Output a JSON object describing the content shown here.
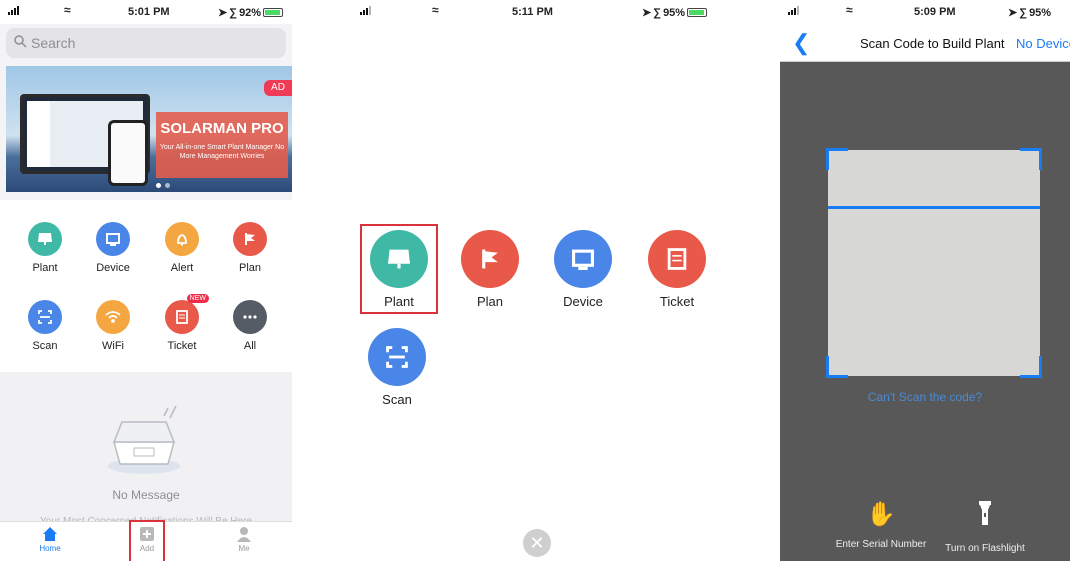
{
  "colors": {
    "accent_blue": "#1a7cf5",
    "highlight_red": "#d8323c",
    "plant_teal": "#3fb9a6",
    "device_blue": "#4a86e8",
    "alert_orange": "#f4a640",
    "plan_red": "#e8594a",
    "scan_blue": "#4a86e8",
    "wifi_orange": "#f4a640",
    "ticket_red": "#e8594a",
    "all_gray": "#555c66"
  },
  "panel1": {
    "status": {
      "time": "5:01 PM",
      "battery": "92%"
    },
    "search": {
      "placeholder": "Search"
    },
    "banner": {
      "badge": "AD",
      "title": "SOLARMAN PRO",
      "subtitle": "Your All-in-one Smart Plant Manager No More Management Worries"
    },
    "grid": [
      {
        "label": "Plant",
        "icon": "solar-panel-icon"
      },
      {
        "label": "Device",
        "icon": "device-icon"
      },
      {
        "label": "Alert",
        "icon": "bell-icon"
      },
      {
        "label": "Plan",
        "icon": "flag-icon"
      },
      {
        "label": "Scan",
        "icon": "scan-icon"
      },
      {
        "label": "WiFi",
        "icon": "wifi-icon"
      },
      {
        "label": "Ticket",
        "icon": "ticket-icon",
        "badge": "NEW"
      },
      {
        "label": "All",
        "icon": "more-icon"
      }
    ],
    "message": {
      "empty": "No Message",
      "sub": "Your Most Concerned Notifications Will Be Here"
    },
    "tabs": [
      {
        "label": "Home",
        "icon": "home-icon"
      },
      {
        "label": "Add",
        "icon": "add-icon"
      },
      {
        "label": "Me",
        "icon": "user-icon"
      }
    ]
  },
  "panel2": {
    "status": {
      "time": "5:11 PM",
      "battery": "95%"
    },
    "items": [
      {
        "label": "Plant",
        "icon": "solar-panel-icon"
      },
      {
        "label": "Plan",
        "icon": "flag-icon"
      },
      {
        "label": "Device",
        "icon": "device-icon"
      },
      {
        "label": "Ticket",
        "icon": "ticket-icon"
      },
      {
        "label": "Scan",
        "icon": "scan-icon"
      }
    ]
  },
  "panel3": {
    "status": {
      "time": "5:09 PM",
      "battery": "95%"
    },
    "nav": {
      "title": "Scan Code to Build Plant",
      "right": "No Device"
    },
    "cant_scan": "Can't Scan the code?",
    "actions": [
      {
        "label": "Enter Serial Number",
        "icon": "hand-icon"
      },
      {
        "label": "Turn on Flashlight",
        "icon": "flashlight-icon"
      }
    ]
  }
}
